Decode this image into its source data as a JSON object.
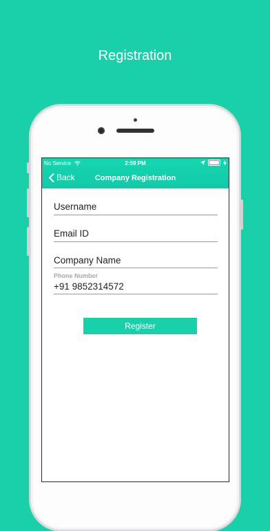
{
  "promo": {
    "title": "Registration"
  },
  "status_bar": {
    "carrier": "No Service",
    "time": "2:59 PM"
  },
  "nav": {
    "back_label": "Back",
    "title": "Company Registration"
  },
  "form": {
    "username_placeholder": "Username",
    "email_placeholder": "Email ID",
    "company_placeholder": "Company Name",
    "phone_label": "Phone Number",
    "phone_value": "+91 9852314572",
    "register_label": "Register"
  },
  "colors": {
    "accent": "#19d0aa",
    "background": "#19d0aa"
  }
}
